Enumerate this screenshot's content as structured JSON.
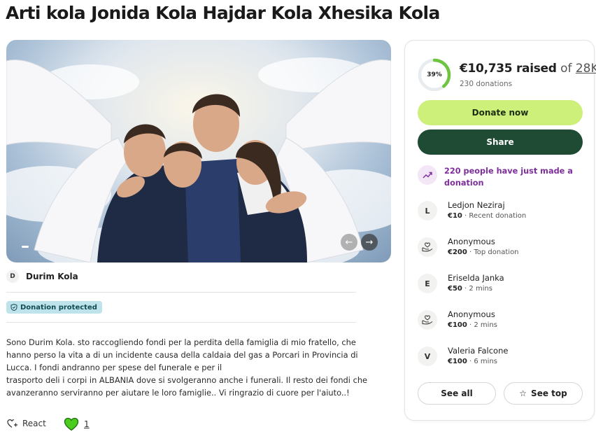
{
  "page": {
    "title": "Arti kola Jonida Kola Hajdar Kola Xhesika Kola"
  },
  "organizer": {
    "initial": "D",
    "name": "Durim Kola"
  },
  "badge": {
    "label": "Donation protected"
  },
  "story": {
    "lines": [
      "Sono Durim Kola. sto raccogliendo fondi per la perdita della famiglia di mio fratello, che",
      "hanno perso la vita a di un incidente causa della caldaia del gas a Porcari in Provincia di",
      "Lucca. I fondi andranno per spese del funerale e per il",
      "trasporto deli i corpi in ALBANIA dove si svolgeranno anche i funerali. Il resto dei fondi che",
      "avanzeranno serviranno per aiutare le loro famiglie.. Vi ringrazio di cuore per l'aiuto..!"
    ]
  },
  "reactions": {
    "react_label": "React",
    "heart_count": "1"
  },
  "fundraiser": {
    "progress_percent": 39,
    "progress_label": "39%",
    "raised": "€10,735 raised",
    "of": "of",
    "goal": "28K",
    "donations": "230 donations",
    "donate_label": "Donate now",
    "share_label": "Share",
    "trend_text": "220 people have just made a donation"
  },
  "donors": [
    {
      "initial": "L",
      "name": "Ledjon Neziraj",
      "amount": "€10",
      "note": " · Recent donation",
      "icon": "letter"
    },
    {
      "initial": "",
      "name": "Anonymous",
      "amount": "€200",
      "note": " · Top donation",
      "icon": "hand-heart-icon"
    },
    {
      "initial": "E",
      "name": "Eriselda Janka",
      "amount": "€50",
      "note": " · 2 mins",
      "icon": "letter"
    },
    {
      "initial": "",
      "name": "Anonymous",
      "amount": "€100",
      "note": " · 2 mins",
      "icon": "hand-heart-icon"
    },
    {
      "initial": "V",
      "name": "Valeria Falcone",
      "amount": "€100",
      "note": " · 6 mins",
      "icon": "letter"
    }
  ],
  "actions": {
    "see_all": "See all",
    "see_top": "See top"
  },
  "colors": {
    "accent_green": "#cdf07a",
    "share_green": "#1f4b34",
    "progress_green": "#6ec43f",
    "trend_purple": "#7d2f9a",
    "badge_teal": "#bfe3ea"
  }
}
